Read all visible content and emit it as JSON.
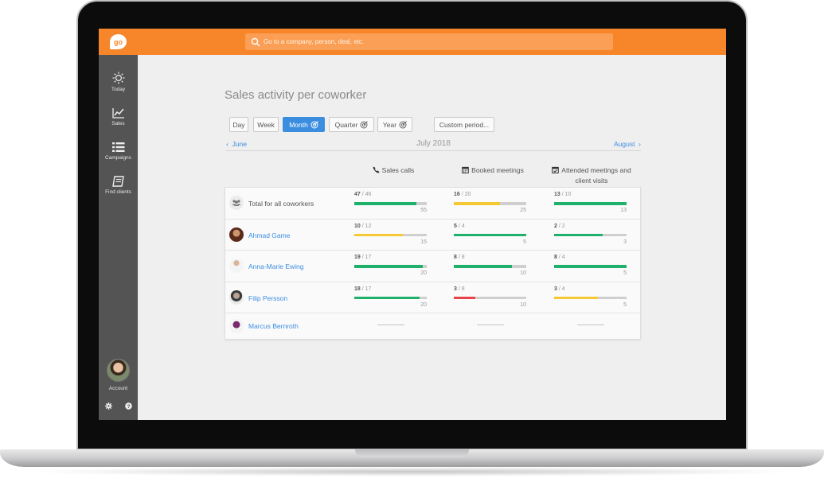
{
  "search": {
    "placeholder": "Go to a company, person, deal, etc."
  },
  "logo": "go",
  "sidebar": {
    "items": [
      {
        "label": "Today",
        "icon": "sun-icon"
      },
      {
        "label": "Sales",
        "icon": "chart-icon"
      },
      {
        "label": "Campaigns",
        "icon": "list-icon"
      },
      {
        "label": "Find clients",
        "icon": "book-icon"
      }
    ],
    "account_label": "Account"
  },
  "page": {
    "title": "Sales activity per coworker",
    "periods": {
      "day": "Day",
      "week": "Week",
      "month": "Month",
      "quarter": "Quarter",
      "year": "Year",
      "custom": "Custom period..."
    },
    "active_period": "Month",
    "month_nav": {
      "prev": "June",
      "current": "July 2018",
      "next": "August"
    }
  },
  "columns": {
    "calls": "Sales calls",
    "meetings": "Booked meetings",
    "attended_line1": "Attended meetings and",
    "attended_line2": "client visits"
  },
  "colors": {
    "green": "#1fb16b",
    "yellow": "#f5c933",
    "red": "#e8434a",
    "accent": "#3b8de0",
    "orange": "#f7862b"
  },
  "rows": [
    {
      "name": "Total for all coworkers",
      "calls": {
        "done": "47",
        "prev": "/ 46",
        "target": "55",
        "fill": 0.855,
        "color": "green"
      },
      "meetings": {
        "done": "16",
        "prev": "/ 20",
        "target": "25",
        "fill": 0.64,
        "color": "yellow"
      },
      "attended": {
        "done": "13",
        "prev": "/ 10",
        "target": "13",
        "fill": 1.0,
        "color": "green"
      }
    },
    {
      "name": "Ahmad Game",
      "calls": {
        "done": "10",
        "prev": "/ 12",
        "target": "15",
        "fill": 0.667,
        "color": "yellow"
      },
      "meetings": {
        "done": "5",
        "prev": "/ 4",
        "target": "5",
        "fill": 1.0,
        "color": "green"
      },
      "attended": {
        "done": "2",
        "prev": "/ 2",
        "target": "3",
        "fill": 0.667,
        "color": "green"
      }
    },
    {
      "name": "Anna-Marie Ewing",
      "calls": {
        "done": "19",
        "prev": "/ 17",
        "target": "20",
        "fill": 0.95,
        "color": "green"
      },
      "meetings": {
        "done": "8",
        "prev": "/ 8",
        "target": "10",
        "fill": 0.8,
        "color": "green"
      },
      "attended": {
        "done": "8",
        "prev": "/ 4",
        "target": "5",
        "fill": 1.0,
        "color": "green"
      }
    },
    {
      "name": "Filip Persson",
      "calls": {
        "done": "18",
        "prev": "/ 17",
        "target": "20",
        "fill": 0.9,
        "color": "green"
      },
      "meetings": {
        "done": "3",
        "prev": "/ 8",
        "target": "10",
        "fill": 0.3,
        "color": "red"
      },
      "attended": {
        "done": "3",
        "prev": "/ 4",
        "target": "5",
        "fill": 0.6,
        "color": "yellow"
      }
    },
    {
      "name": "Marcus Bernroth"
    }
  ]
}
